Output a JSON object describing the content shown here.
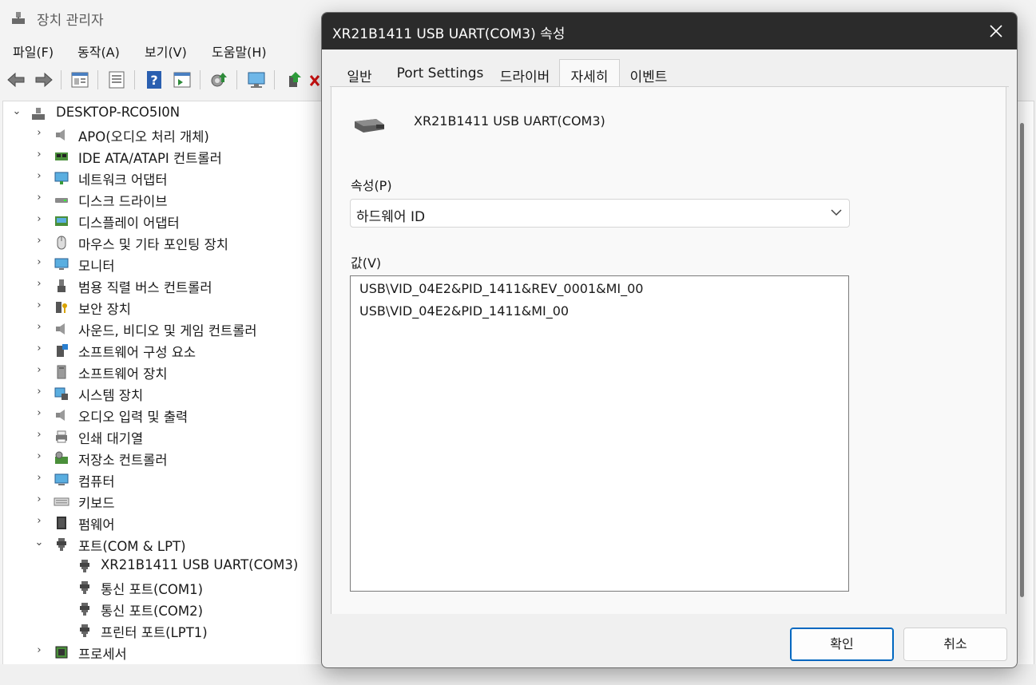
{
  "app": {
    "title": "장치 관리자",
    "menus": [
      "파일(F)",
      "동작(A)",
      "보기(V)",
      "도움말(H)"
    ]
  },
  "tree": {
    "root": "DESKTOP-RCO5I0N",
    "categories": [
      {
        "label": "APO(오디오 처리 개체)",
        "icon": "speaker-icon"
      },
      {
        "label": "IDE ATA/ATAPI 컨트롤러",
        "icon": "ide-controller-icon"
      },
      {
        "label": "네트워크 어댑터",
        "icon": "network-adapter-icon"
      },
      {
        "label": "디스크 드라이브",
        "icon": "disk-drive-icon"
      },
      {
        "label": "디스플레이 어댑터",
        "icon": "display-adapter-icon"
      },
      {
        "label": "마우스 및 기타 포인팅 장치",
        "icon": "mouse-icon"
      },
      {
        "label": "모니터",
        "icon": "monitor-icon"
      },
      {
        "label": "범용 직렬 버스 컨트롤러",
        "icon": "usb-icon"
      },
      {
        "label": "보안 장치",
        "icon": "security-key-icon"
      },
      {
        "label": "사운드, 비디오 및 게임 컨트롤러",
        "icon": "speaker-icon"
      },
      {
        "label": "소프트웨어 구성 요소",
        "icon": "software-component-icon"
      },
      {
        "label": "소프트웨어 장치",
        "icon": "software-device-icon"
      },
      {
        "label": "시스템 장치",
        "icon": "system-device-icon"
      },
      {
        "label": "오디오 입력 및 출력",
        "icon": "speaker-icon"
      },
      {
        "label": "인쇄 대기열",
        "icon": "printer-icon"
      },
      {
        "label": "저장소 컨트롤러",
        "icon": "storage-controller-icon"
      },
      {
        "label": "컴퓨터",
        "icon": "computer-icon"
      },
      {
        "label": "키보드",
        "icon": "keyboard-icon"
      },
      {
        "label": "펌웨어",
        "icon": "firmware-icon"
      },
      {
        "label": "포트(COM & LPT)",
        "icon": "port-icon",
        "expanded": true,
        "children": [
          "XR21B1411 USB UART(COM3)",
          "통신 포트(COM1)",
          "통신 포트(COM2)",
          "프린터 포트(LPT1)"
        ]
      },
      {
        "label": "프로세서",
        "icon": "processor-icon"
      }
    ]
  },
  "dialog": {
    "title": "XR21B1411 USB UART(COM3) 속성",
    "tabs": [
      "일반",
      "Port Settings",
      "드라이버",
      "자세히",
      "이벤트"
    ],
    "active_tab": "자세히",
    "device_name": "XR21B1411 USB UART(COM3)",
    "property_label": "속성(P)",
    "property_value": "하드웨어 ID",
    "value_label": "값(V)",
    "values": [
      "USB\\VID_04E2&PID_1411&REV_0001&MI_00",
      "USB\\VID_04E2&PID_1411&MI_00"
    ],
    "ok_label": "확인",
    "cancel_label": "취소"
  },
  "colors": {
    "dialog_titlebar": "#2b2b2b",
    "accent": "#0067c0"
  }
}
